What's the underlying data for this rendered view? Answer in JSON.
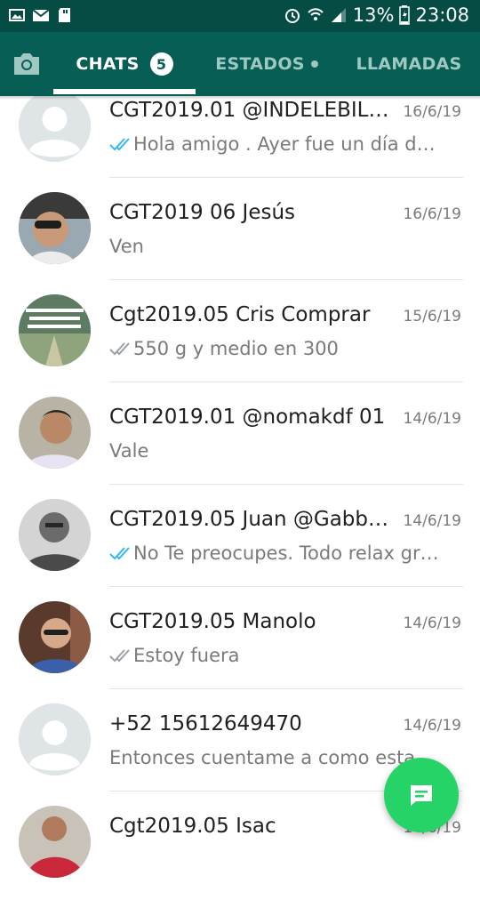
{
  "status_bar": {
    "battery": "13%",
    "time": "23:08",
    "icons": [
      "image-icon",
      "mail-icon",
      "sd-card-icon",
      "alarm-icon",
      "wifi-icon",
      "signal-icon",
      "battery-icon"
    ]
  },
  "tabs": {
    "camera_icon": "camera-icon",
    "chats": "CHATS",
    "chats_badge": "5",
    "estados": "ESTADOS",
    "llamadas": "LLAMADAS"
  },
  "chats": [
    {
      "name": "CGT2019.01 @INDELEBIL…",
      "date": "16/6/19",
      "preview": "Hola amigo . Ayer fue un día del…",
      "ticks": "read",
      "avatar": "default"
    },
    {
      "name": "CGT2019 06 Jesús",
      "date": "16/6/19",
      "preview": "Ven",
      "ticks": "none",
      "avatar": "photo"
    },
    {
      "name": "Cgt2019.05 Cris Comprar",
      "date": "15/6/19",
      "preview": "550 g y medio en 300",
      "ticks": "delivered",
      "avatar": "photo"
    },
    {
      "name": "CGT2019.01 @nomakdf 01",
      "date": "14/6/19",
      "preview": "Vale",
      "ticks": "none",
      "avatar": "photo"
    },
    {
      "name": "CGT2019.05 Juan @Gabb…",
      "date": "14/6/19",
      "preview": "No Te preocupes.  Todo relax gra…",
      "ticks": "read",
      "avatar": "photo"
    },
    {
      "name": "CGT2019.05 Manolo",
      "date": "14/6/19",
      "preview": "Estoy fuera",
      "ticks": "delivered",
      "avatar": "photo"
    },
    {
      "name": "+52 15612649470",
      "date": "14/6/19",
      "preview": "Entonces cuentame a como esta co…",
      "ticks": "none",
      "avatar": "default"
    },
    {
      "name": "Cgt2019.05 Isac",
      "date": "14/6/19",
      "preview": "",
      "ticks": "none",
      "avatar": "photo"
    }
  ],
  "fab": {
    "icon": "new-chat-icon"
  },
  "colors": {
    "header": "#075e54",
    "status_bar": "#054d44",
    "accent": "#25d366",
    "read_ticks": "#34b7f1"
  }
}
